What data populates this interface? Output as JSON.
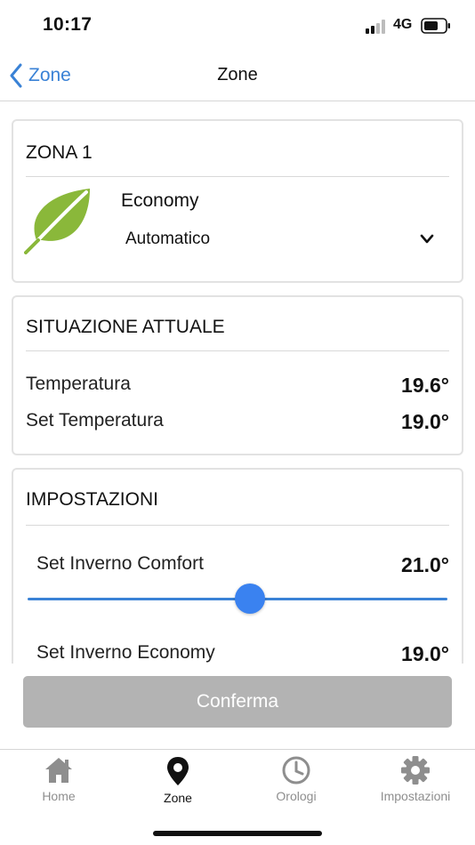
{
  "status_bar": {
    "time": "10:17",
    "network": "4G"
  },
  "nav": {
    "back_label": "Zone",
    "title": "Zone"
  },
  "zone_card": {
    "title": "ZONA 1",
    "mode_label": "Economy",
    "selected_mode": "Automatico",
    "icon": "leaf-icon"
  },
  "status_card": {
    "title": "SITUAZIONE ATTUALE",
    "rows": [
      {
        "label": "Temperatura",
        "value": "19.6°"
      },
      {
        "label": "Set Temperatura",
        "value": "19.0°"
      }
    ]
  },
  "settings_card": {
    "title": "IMPOSTAZIONI",
    "settings": [
      {
        "label": "Set Inverno Comfort",
        "value": "21.0°",
        "slider_fraction": 0.53
      },
      {
        "label": "Set Inverno Economy",
        "value": "19.0°"
      }
    ]
  },
  "confirm_button": {
    "label": "Conferma",
    "enabled": false
  },
  "tab_bar": {
    "tabs": [
      {
        "label": "Home",
        "icon": "home-icon",
        "active": false
      },
      {
        "label": "Zone",
        "icon": "location-pin-icon",
        "active": true
      },
      {
        "label": "Orologi",
        "icon": "clock-icon",
        "active": false
      },
      {
        "label": "Impostazioni",
        "icon": "gear-icon",
        "active": false
      }
    ]
  },
  "colors": {
    "accent": "#3a82d6",
    "slider_thumb": "#3a82f0",
    "leaf_green": "#8ab83a",
    "disabled_button": "#b3b3b3",
    "inactive_tab": "#8e8e8e"
  }
}
